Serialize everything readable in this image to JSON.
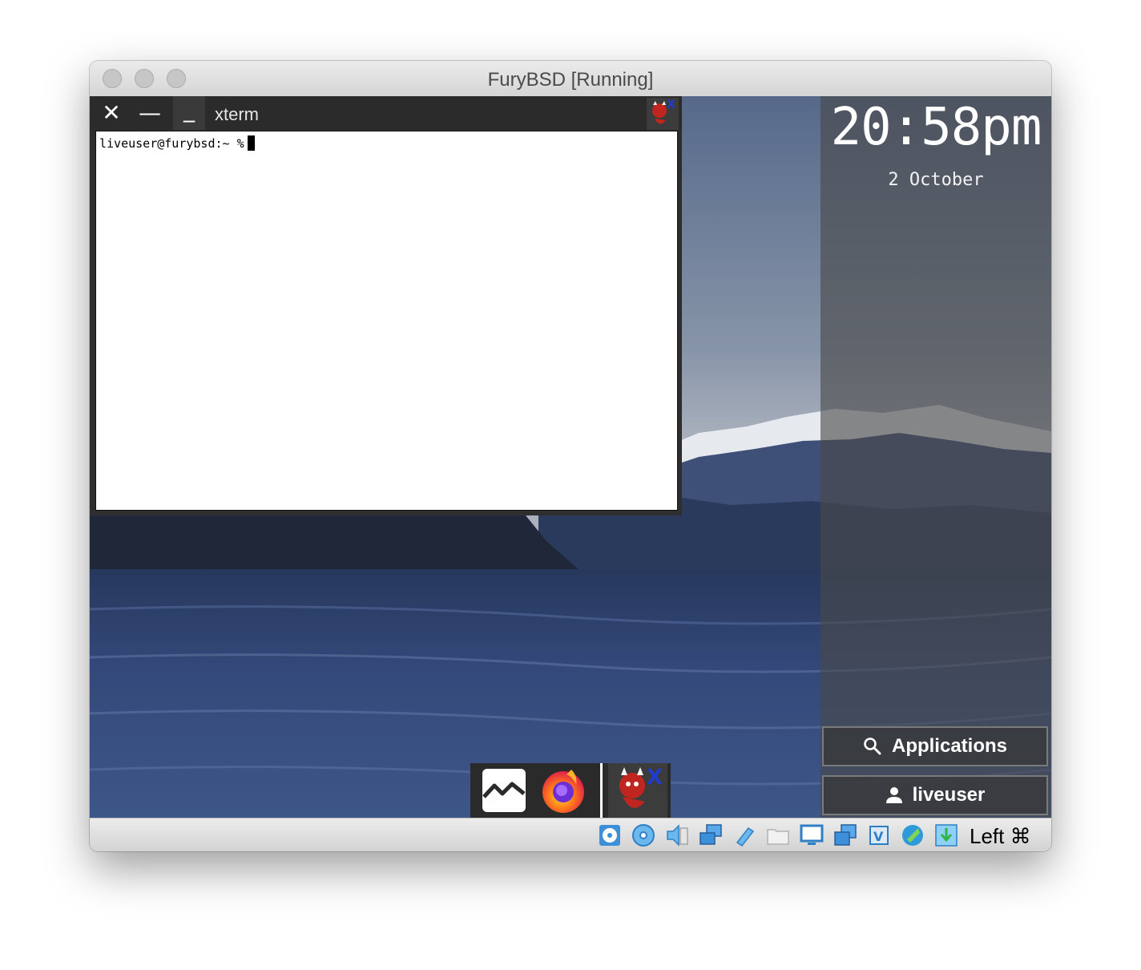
{
  "window": {
    "title": "FuryBSD [Running]"
  },
  "xterm": {
    "title": "xterm",
    "close_glyph": "✕",
    "maximize_glyph": "—",
    "minimize_glyph": "_",
    "prompt": "liveuser@furybsd:~ %",
    "logo_icon": "bsd-daemon-x-icon"
  },
  "side_panel": {
    "time": "20:58pm",
    "date": "2 October",
    "applications_label": "Applications",
    "user_label": "liveuser"
  },
  "dock": {
    "items": [
      {
        "name": "system-monitor-icon"
      },
      {
        "name": "firefox-icon"
      },
      {
        "name": "xterm-daemon-icon"
      }
    ]
  },
  "statusbar": {
    "host_key": "Left ⌘",
    "icons": [
      "hard-disk-icon",
      "optical-drive-icon",
      "audio-icon",
      "network-icon",
      "usb-icon",
      "shared-folders-icon",
      "display-icon",
      "video-capture-icon",
      "cpu-icon",
      "mouse-integration-icon",
      "keyboard-capture-icon"
    ]
  },
  "colors": {
    "panel": "#484848",
    "terminal_bg": "#ffffff",
    "titlebar_dark": "#2b2b2b"
  }
}
